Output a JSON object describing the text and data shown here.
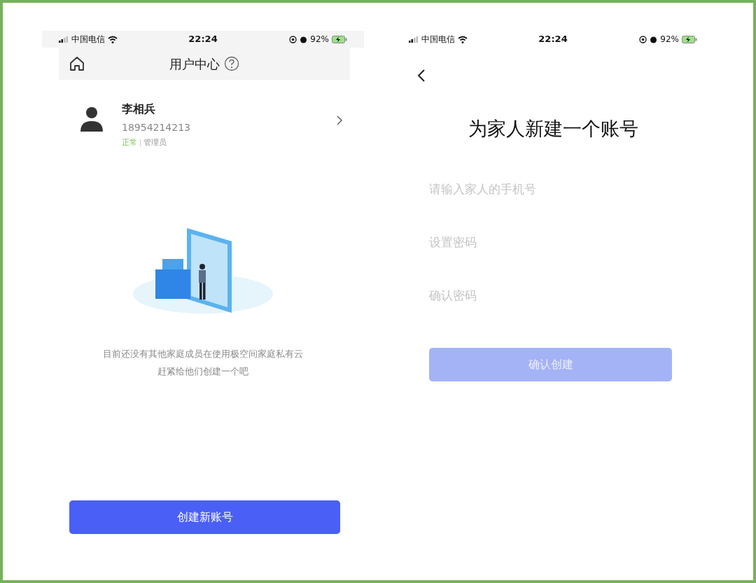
{
  "left_screen": {
    "status_bar": {
      "carrier": "中国电信",
      "time": "22:24",
      "battery": "92%"
    },
    "header": {
      "title": "用户中心"
    },
    "profile": {
      "name": "李相兵",
      "phone": "18954214213",
      "status": "正常",
      "role": "管理员"
    },
    "empty_message": [
      "目前还没有其他家庭成员在使用极空间家庭私有云",
      "赶紧给他们创建一个吧"
    ],
    "button": {
      "label": "创建新账号",
      "disabled": false
    }
  },
  "right_screen": {
    "status_bar": {
      "carrier": "中国电信",
      "time": "22:24",
      "battery": "92%"
    },
    "title": "为家人新建一个账号",
    "fields": [
      {
        "placeholder": "请输入家人的手机号"
      },
      {
        "placeholder": "设置密码"
      },
      {
        "placeholder": "确认密码"
      }
    ],
    "button": {
      "label": "确认创建",
      "disabled": true
    }
  }
}
